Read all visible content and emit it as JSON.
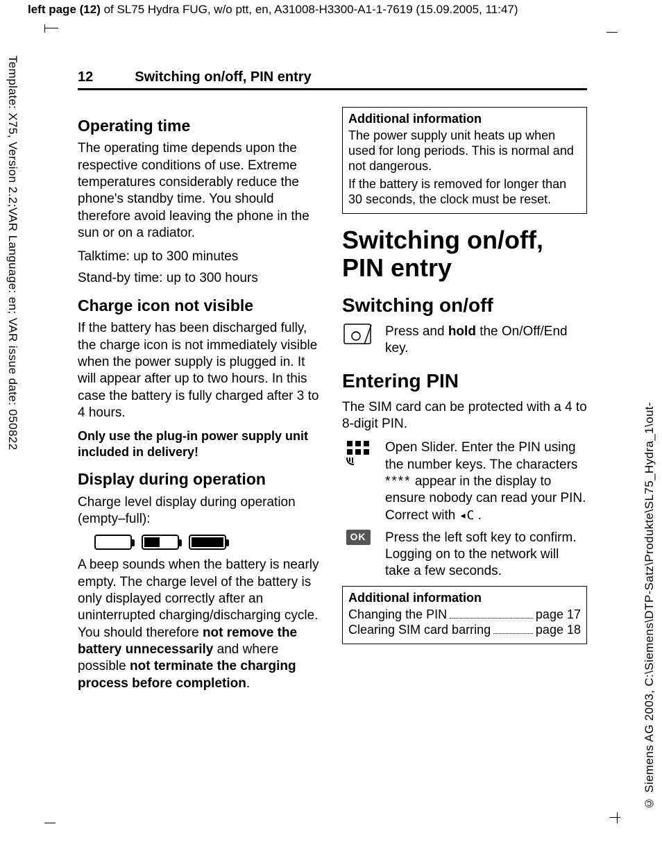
{
  "meta": {
    "top_banner_bold": "left page (12)",
    "top_banner_rest": " of SL75 Hydra FUG, w/o ptt, en, A31008-H3300-A1-1-7619 (15.09.2005, 11:47)",
    "vtext_left": "Template: X75, Version 2.2;VAR Language: en; VAR issue date: 050822",
    "vtext_right": "© Siemens AG 2003, C:\\Siemens\\DTP-Satz\\Produkte\\SL75_Hydra_1\\out-"
  },
  "header": {
    "page_number": "12",
    "running_title": "Switching on/off, PIN entry"
  },
  "left": {
    "h_operating": "Operating time",
    "p_operating": "The operating time depends upon the respective conditions of use. Extreme temperatures considerably reduce the phone's standby time. You should therefore avoid leaving the phone in the sun or on a radiator.",
    "p_talktime": "Talktime: up to 300 minutes",
    "p_standby": "Stand-by time: up to 300 hours",
    "h_charge_icon": "Charge icon not visible",
    "p_charge_icon": "If the battery has been discharged fully, the charge icon is not immediately visible when the power supply is plugged in. It will appear after up to two hours. In this case the battery is fully charged after 3 to 4 hours.",
    "p_only_use": "Only use the plug-in power supply unit included in delivery!",
    "h_display": "Display during operation",
    "p_display_intro": "Charge level display during operation (empty–full):",
    "p_beep_1": "A beep sounds when the battery is nearly empty. The charge level of the battery is only displayed correctly after an uninterrupted charging/discharging cycle. You should therefore ",
    "p_beep_b1": "not remove the battery unnecessarily",
    "p_beep_2": " and where possible ",
    "p_beep_b2": "not terminate the charging process before completion",
    "p_beep_3": "."
  },
  "right": {
    "box1_title": "Additional information",
    "box1_p1": "The power supply unit heats up when used for long periods. This is normal and not dangerous.",
    "box1_p2": "If the battery is removed for longer than 30 seconds, the clock must be reset.",
    "chapter": "Switching on/off, PIN entry",
    "h_switching": "Switching on/off",
    "switch_text_1": "Press and ",
    "switch_text_bold": "hold",
    "switch_text_2": " the On/Off/End key.",
    "h_pin": "Entering PIN",
    "p_pin_intro": "The SIM card can be protected with a 4 to 8-digit PIN.",
    "keypad_text_1": "Open Slider. Enter the PIN using the number keys. The characters ",
    "keypad_asterisks": "****",
    "keypad_text_2": " appear in the display to ensure nobody can read your PIN. Correct with ",
    "keypad_clear": "◂C",
    "keypad_text_3": " .",
    "ok_label": "OK",
    "ok_text": "Press the left soft key to confirm. Logging on to the network will take a few seconds.",
    "box2_title": "Additional information",
    "box2_r1_label": "Changing the PIN ",
    "box2_r1_page": "page 17",
    "box2_r2_label": "Clearing SIM card barring",
    "box2_r2_page": "page 18"
  }
}
